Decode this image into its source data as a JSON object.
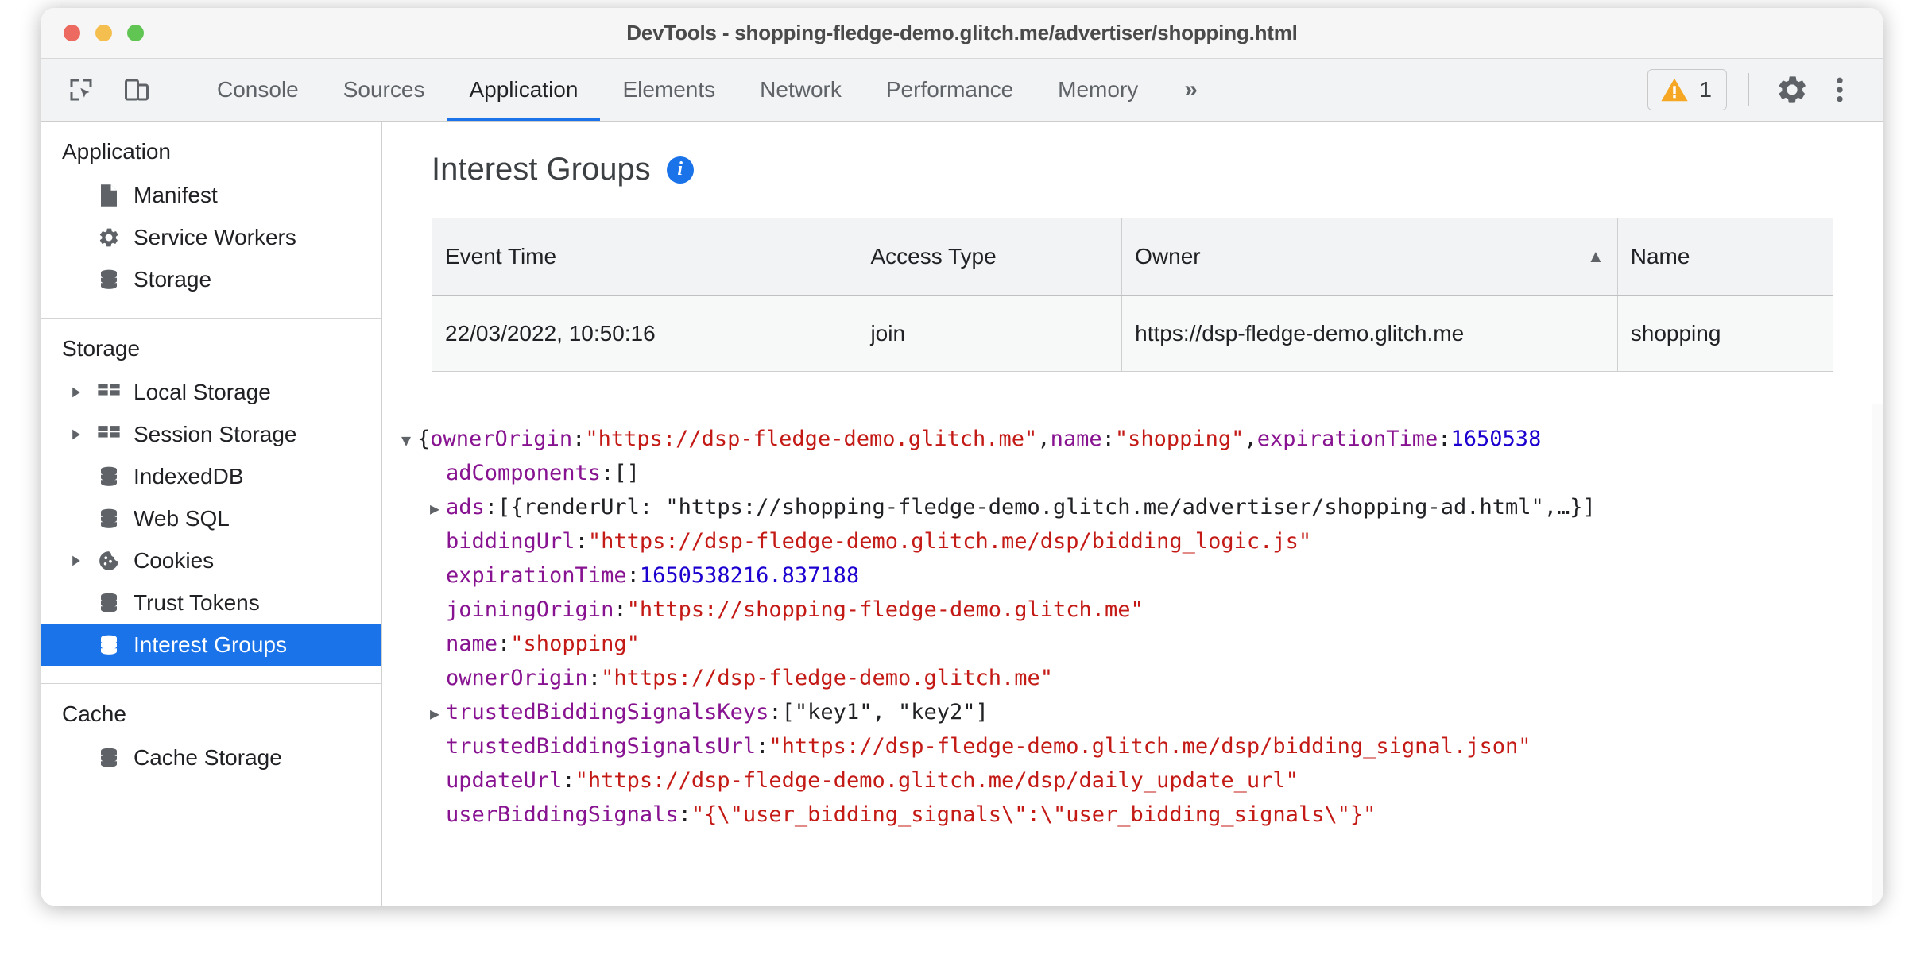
{
  "window": {
    "title": "DevTools - shopping-fledge-demo.glitch.me/advertiser/shopping.html"
  },
  "toolbar": {
    "inspect_tooltip": "Inspect element",
    "device_tooltip": "Toggle device toolbar",
    "tabs": [
      {
        "label": "Console",
        "active": false
      },
      {
        "label": "Sources",
        "active": false
      },
      {
        "label": "Application",
        "active": true
      },
      {
        "label": "Elements",
        "active": false
      },
      {
        "label": "Network",
        "active": false
      },
      {
        "label": "Performance",
        "active": false
      },
      {
        "label": "Memory",
        "active": false
      }
    ],
    "more_tabs_label": "»",
    "warning_count": "1",
    "settings_label": "Settings",
    "more_options_label": "Customize and control DevTools"
  },
  "sidebar": {
    "sections": [
      {
        "heading": "Application",
        "items": [
          {
            "label": "Manifest",
            "icon": "manifest-icon",
            "caret": false,
            "selected": false
          },
          {
            "label": "Service Workers",
            "icon": "gear-icon",
            "caret": false,
            "selected": false
          },
          {
            "label": "Storage",
            "icon": "database-icon",
            "caret": false,
            "selected": false
          }
        ]
      },
      {
        "heading": "Storage",
        "items": [
          {
            "label": "Local Storage",
            "icon": "table-icon",
            "caret": true,
            "selected": false
          },
          {
            "label": "Session Storage",
            "icon": "table-icon",
            "caret": true,
            "selected": false
          },
          {
            "label": "IndexedDB",
            "icon": "database-icon",
            "caret": false,
            "selected": false
          },
          {
            "label": "Web SQL",
            "icon": "database-icon",
            "caret": false,
            "selected": false
          },
          {
            "label": "Cookies",
            "icon": "cookie-icon",
            "caret": true,
            "selected": false
          },
          {
            "label": "Trust Tokens",
            "icon": "database-icon",
            "caret": false,
            "selected": false
          },
          {
            "label": "Interest Groups",
            "icon": "database-icon",
            "caret": false,
            "selected": true
          }
        ]
      },
      {
        "heading": "Cache",
        "items": [
          {
            "label": "Cache Storage",
            "icon": "database-icon",
            "caret": false,
            "selected": false
          }
        ]
      }
    ]
  },
  "main": {
    "panel_title": "Interest Groups",
    "info_glyph": "i",
    "table": {
      "columns": [
        {
          "label": "Event Time",
          "sorted": false
        },
        {
          "label": "Access Type",
          "sorted": false
        },
        {
          "label": "Owner",
          "sorted": true,
          "sort_arrow": "▲"
        },
        {
          "label": "Name",
          "sorted": false
        }
      ],
      "rows": [
        {
          "event_time": "22/03/2022, 10:50:16",
          "access_type": "join",
          "owner": "https://dsp-fledge-demo.glitch.me",
          "name": "shopping"
        }
      ]
    },
    "json_tree": {
      "root": {
        "triangle": "▼",
        "prefix": "{",
        "key1": "ownerOrigin",
        "sep1": ": ",
        "val1": "\"https://dsp-fledge-demo.glitch.me\"",
        "comma1": ", ",
        "key2": "name",
        "sep2": ": ",
        "val2": "\"shopping\"",
        "comma2": ", ",
        "key3": "expirationTime",
        "sep3": ": ",
        "val3": "1650538"
      },
      "rows": [
        {
          "triangle": "",
          "key": "adComponents",
          "colon": ": ",
          "value": "[]",
          "value_type": "plain"
        },
        {
          "triangle": "▶",
          "key": "ads",
          "colon": ": ",
          "value": "[{renderUrl: \"https://shopping-fledge-demo.glitch.me/advertiser/shopping-ad.html\",…}]",
          "value_type": "plain"
        },
        {
          "triangle": "",
          "key": "biddingUrl",
          "colon": ": ",
          "value": "\"https://dsp-fledge-demo.glitch.me/dsp/bidding_logic.js\"",
          "value_type": "string"
        },
        {
          "triangle": "",
          "key": "expirationTime",
          "colon": ": ",
          "value": "1650538216.837188",
          "value_type": "number"
        },
        {
          "triangle": "",
          "key": "joiningOrigin",
          "colon": ": ",
          "value": "\"https://shopping-fledge-demo.glitch.me\"",
          "value_type": "string"
        },
        {
          "triangle": "",
          "key": "name",
          "colon": ": ",
          "value": "\"shopping\"",
          "value_type": "string"
        },
        {
          "triangle": "",
          "key": "ownerOrigin",
          "colon": ": ",
          "value": "\"https://dsp-fledge-demo.glitch.me\"",
          "value_type": "string"
        },
        {
          "triangle": "▶",
          "key": "trustedBiddingSignalsKeys",
          "colon": ": ",
          "value": "[\"key1\", \"key2\"]",
          "value_type": "plain"
        },
        {
          "triangle": "",
          "key": "trustedBiddingSignalsUrl",
          "colon": ": ",
          "value": "\"https://dsp-fledge-demo.glitch.me/dsp/bidding_signal.json\"",
          "value_type": "string"
        },
        {
          "triangle": "",
          "key": "updateUrl",
          "colon": ": ",
          "value": "\"https://dsp-fledge-demo.glitch.me/dsp/daily_update_url\"",
          "value_type": "string"
        },
        {
          "triangle": "",
          "key": "userBiddingSignals",
          "colon": ": ",
          "value": "\"{\\\"user_bidding_signals\\\":\\\"user_bidding_signals\\\"}\"",
          "value_type": "string"
        }
      ]
    }
  },
  "colors": {
    "accent": "#1a73e8",
    "warning": "#f5a623",
    "key": "#881391",
    "string": "#c41a16",
    "number": "#1c00cf",
    "toolbar_bg": "#f1f3f4"
  }
}
